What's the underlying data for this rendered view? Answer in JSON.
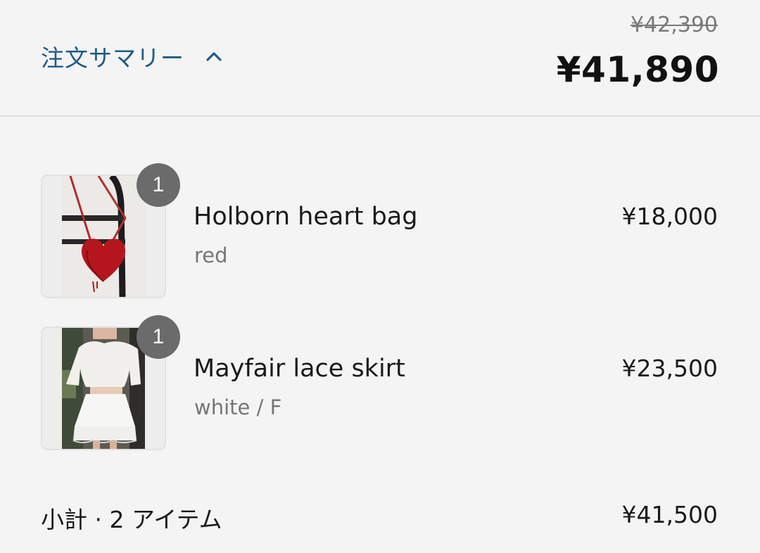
{
  "header": {
    "summary_label": "注文サマリー",
    "compare_at_total": "¥42,390",
    "total": "¥41,890"
  },
  "items": [
    {
      "title": "Holborn heart bag",
      "variant": "red",
      "price": "¥18,000",
      "quantity": "1",
      "image_icon": "heart-bag-photo"
    },
    {
      "title": "Mayfair lace skirt",
      "variant": "white / F",
      "price": "¥23,500",
      "quantity": "1",
      "image_icon": "lace-skirt-photo"
    }
  ],
  "subtotal": {
    "label": "小計 · 2 アイテム",
    "value": "¥41,500"
  },
  "colors": {
    "link": "#1f5b86",
    "badge": "#6b6b6b",
    "background": "#f4f4f4"
  }
}
